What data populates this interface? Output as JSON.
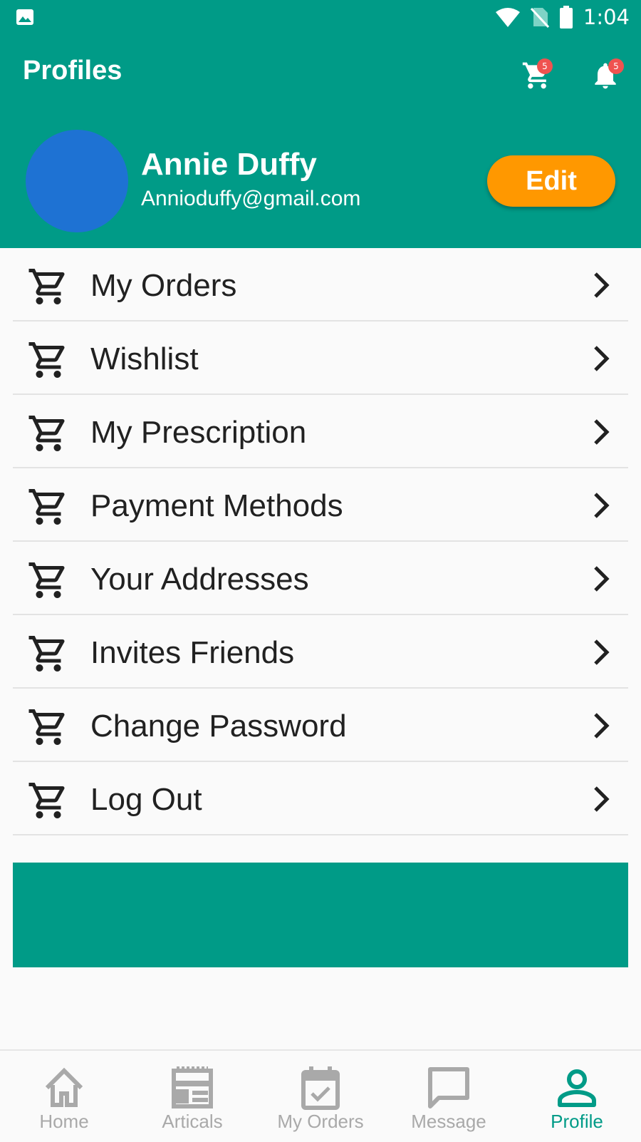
{
  "status_bar": {
    "time": "1:04"
  },
  "header": {
    "title": "Profiles",
    "cart_badge": "5",
    "notification_badge": "5"
  },
  "profile": {
    "name": "Annie Duffy",
    "email": "Annioduffy@gmail.com",
    "edit_label": "Edit"
  },
  "menu": {
    "items": [
      {
        "label": "My Orders"
      },
      {
        "label": "Wishlist"
      },
      {
        "label": "My Prescription"
      },
      {
        "label": "Payment Methods"
      },
      {
        "label": "Your Addresses"
      },
      {
        "label": "Invites Friends"
      },
      {
        "label": "Change Password"
      },
      {
        "label": "Log Out"
      }
    ]
  },
  "bottom_nav": {
    "items": [
      {
        "label": "Home",
        "icon": "home-icon"
      },
      {
        "label": "Articals",
        "icon": "articles-icon"
      },
      {
        "label": "My Orders",
        "icon": "calendar-check-icon"
      },
      {
        "label": "Message",
        "icon": "message-icon"
      },
      {
        "label": "Profile",
        "icon": "person-icon",
        "active": true
      }
    ]
  },
  "colors": {
    "primary": "#009b87",
    "accent": "#ff9800",
    "avatar": "#1e72d3",
    "badge": "#ef5350",
    "inactive_nav": "#a9a9a9"
  }
}
